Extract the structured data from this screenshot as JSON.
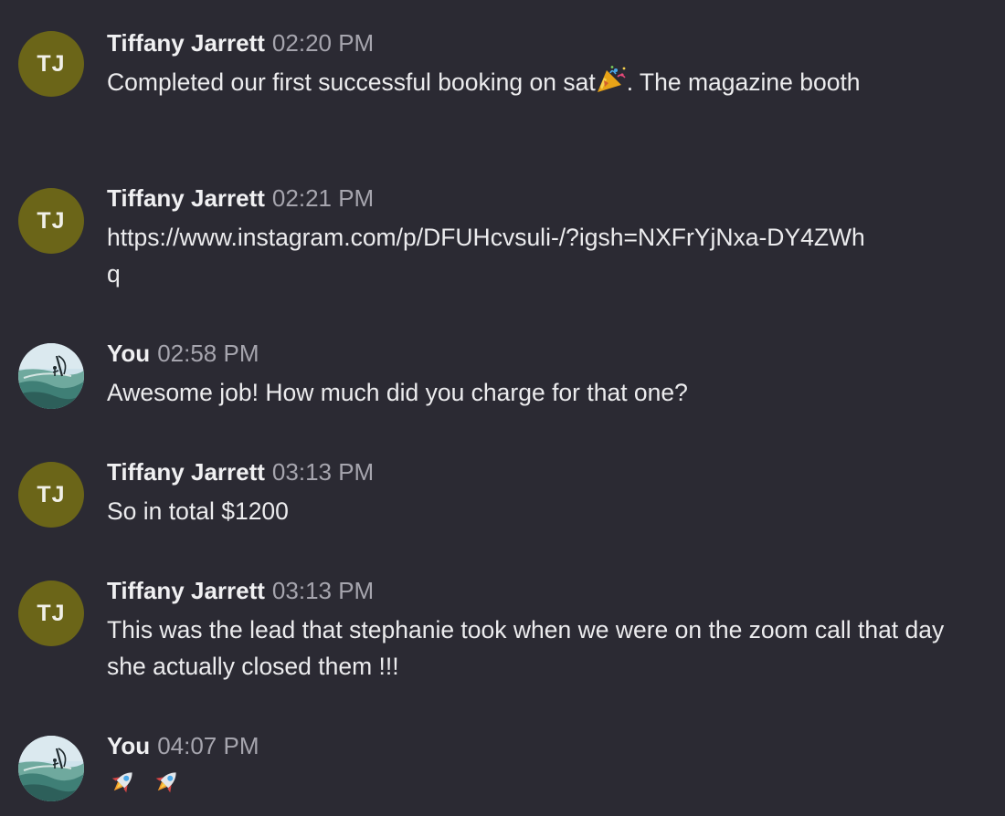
{
  "colors": {
    "background": "#2b2a33",
    "avatar_initials_bg": "#6b6518",
    "author_text": "#f0f0f2",
    "timestamp_text": "#a6a5ae",
    "body_text": "#ececee"
  },
  "messages": [
    {
      "author": "Tiffany Jarrett",
      "initials": "TJ",
      "time": "02:20 PM",
      "text_before": "Completed our first successful booking on sat",
      "emoji": "party-popper-icon",
      "text_after": ". The magazine booth"
    },
    {
      "author": "Tiffany Jarrett",
      "initials": "TJ",
      "time": "02:21 PM",
      "text": "https://www.instagram.com/p/DFUHcvsuli-/?igsh=NXFrYjNxa-DY4ZWhq"
    },
    {
      "author": "You",
      "avatar": "windsurfer-photo-avatar",
      "time": "02:58 PM",
      "text": "Awesome job! How much did you charge for that one?"
    },
    {
      "author": "Tiffany Jarrett",
      "initials": "TJ",
      "time": "03:13 PM",
      "text": "So in total $1200"
    },
    {
      "author": "Tiffany Jarrett",
      "initials": "TJ",
      "time": "03:13 PM",
      "text": "This was the lead that stephanie took when we were on the zoom call that day she actually closed them !!!"
    },
    {
      "author": "You",
      "avatar": "windsurfer-photo-avatar",
      "time": "04:07 PM",
      "emojis": [
        "rocket-icon",
        "rocket-icon"
      ]
    }
  ]
}
